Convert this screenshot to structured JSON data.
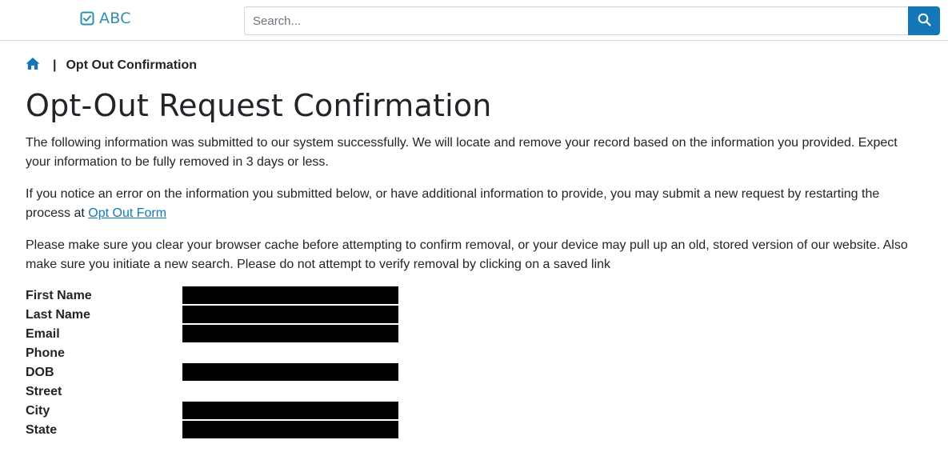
{
  "header": {
    "logo_text": "ABC",
    "search_placeholder": "Search..."
  },
  "breadcrumb": {
    "separator": "|",
    "current": "Opt Out Confirmation"
  },
  "page": {
    "title": "Opt-Out Request Confirmation",
    "para1": "The following information was submitted to our system successfully. We will locate and remove your record based on the information you provided. Expect your information to be fully removed in 3 days or less.",
    "para2_prefix": "If you notice an error on the information you submitted below, or have additional information to provide, you may submit a new request by restarting the process at ",
    "para2_link": "Opt Out Form",
    "para3": "Please make sure you clear your browser cache before attempting to confirm removal, or your device may pull up an old, stored version of our website. Also make sure you initiate a new search. Please do not attempt to verify removal by clicking on a saved link"
  },
  "fields": [
    {
      "label": "First Name",
      "redacted": true
    },
    {
      "label": "Last Name",
      "redacted": true
    },
    {
      "label": "Email",
      "redacted": true
    },
    {
      "label": "Phone",
      "redacted": false
    },
    {
      "label": "DOB",
      "redacted": true
    },
    {
      "label": "Street",
      "redacted": false
    },
    {
      "label": "City",
      "redacted": true
    },
    {
      "label": "State",
      "redacted": true
    }
  ],
  "colors": {
    "brand": "#2c8fb0",
    "accent": "#1478b8",
    "redaction": "#000000"
  },
  "icons": {
    "logo": "checkbox-icon",
    "search": "search-icon",
    "home": "home-icon"
  }
}
